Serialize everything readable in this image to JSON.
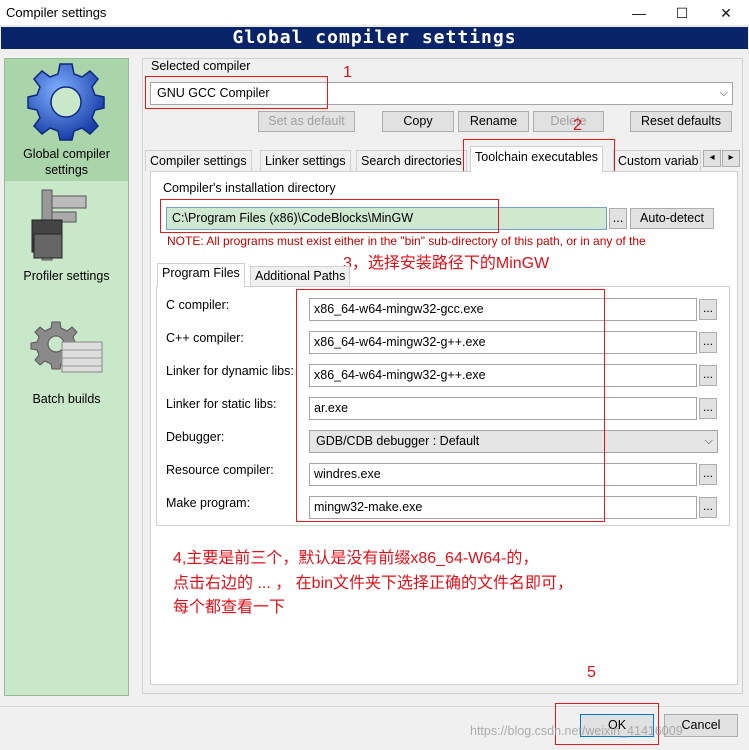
{
  "window": {
    "title": "Compiler settings",
    "minimize": "—",
    "maximize": "☐",
    "close": "✕"
  },
  "banner": "Global compiler settings",
  "sidebar": {
    "items": [
      {
        "label": "Global compiler settings",
        "icon": "gear-icon",
        "selected": true
      },
      {
        "label": "Profiler settings",
        "icon": "caliper-icon",
        "selected": false
      },
      {
        "label": "Batch builds",
        "icon": "batch-gear-icon",
        "selected": false
      }
    ]
  },
  "selected_compiler": {
    "label": "Selected compiler",
    "value": "GNU GCC Compiler"
  },
  "compiler_buttons": {
    "set_default": "Set as default",
    "copy": "Copy",
    "rename": "Rename",
    "delete": "Delete",
    "reset": "Reset defaults"
  },
  "tabs": [
    {
      "label": "Compiler settings"
    },
    {
      "label": "Linker settings"
    },
    {
      "label": "Search directories"
    },
    {
      "label": "Toolchain executables"
    },
    {
      "label": "Custom variab"
    }
  ],
  "tab_scroll": {
    "left": "◂",
    "right": "▸"
  },
  "install_dir": {
    "label": "Compiler's installation directory",
    "value": "C:\\Program Files (x86)\\CodeBlocks\\MinGW",
    "browse": "...",
    "auto_detect": "Auto-detect",
    "note": "NOTE: All programs must exist either in the \"bin\" sub-directory of this path, or in any of the"
  },
  "subtabs": [
    {
      "label": "Program Files"
    },
    {
      "label": "Additional Paths"
    }
  ],
  "programs": [
    {
      "label": "C compiler:",
      "value": "x86_64-w64-mingw32-gcc.exe"
    },
    {
      "label": "C++ compiler:",
      "value": "x86_64-w64-mingw32-g++.exe"
    },
    {
      "label": "Linker for dynamic libs:",
      "value": "x86_64-w64-mingw32-g++.exe"
    },
    {
      "label": "Linker for static libs:",
      "value": "ar.exe"
    },
    {
      "label": "Debugger:",
      "value": "GDB/CDB debugger : Default"
    },
    {
      "label": "Resource compiler:",
      "value": "windres.exe"
    },
    {
      "label": "Make program:",
      "value": "mingw32-make.exe"
    }
  ],
  "browse_label": "...",
  "annotations": {
    "n1": "1",
    "n2": "2",
    "n3": "3，选择安装路径下的MinGW",
    "n4_line1": "4,主要是前三个，默认是没有前缀x86_64-W64-的，",
    "n4_line2": "点击右边的 ... ， 在bin文件夹下选择正确的文件名即可，",
    "n4_line3": "每个都查看一下",
    "n5": "5"
  },
  "footer": {
    "ok": "OK",
    "cancel": "Cancel",
    "watermark": "https://blog.csdn.net/weixin_41416009"
  },
  "colors": {
    "banner_bg": "#0a246a",
    "sidebar_bg": "#c9e8c9",
    "annotation_red": "#e0101a",
    "path_highlight": "#cfe8d0"
  }
}
